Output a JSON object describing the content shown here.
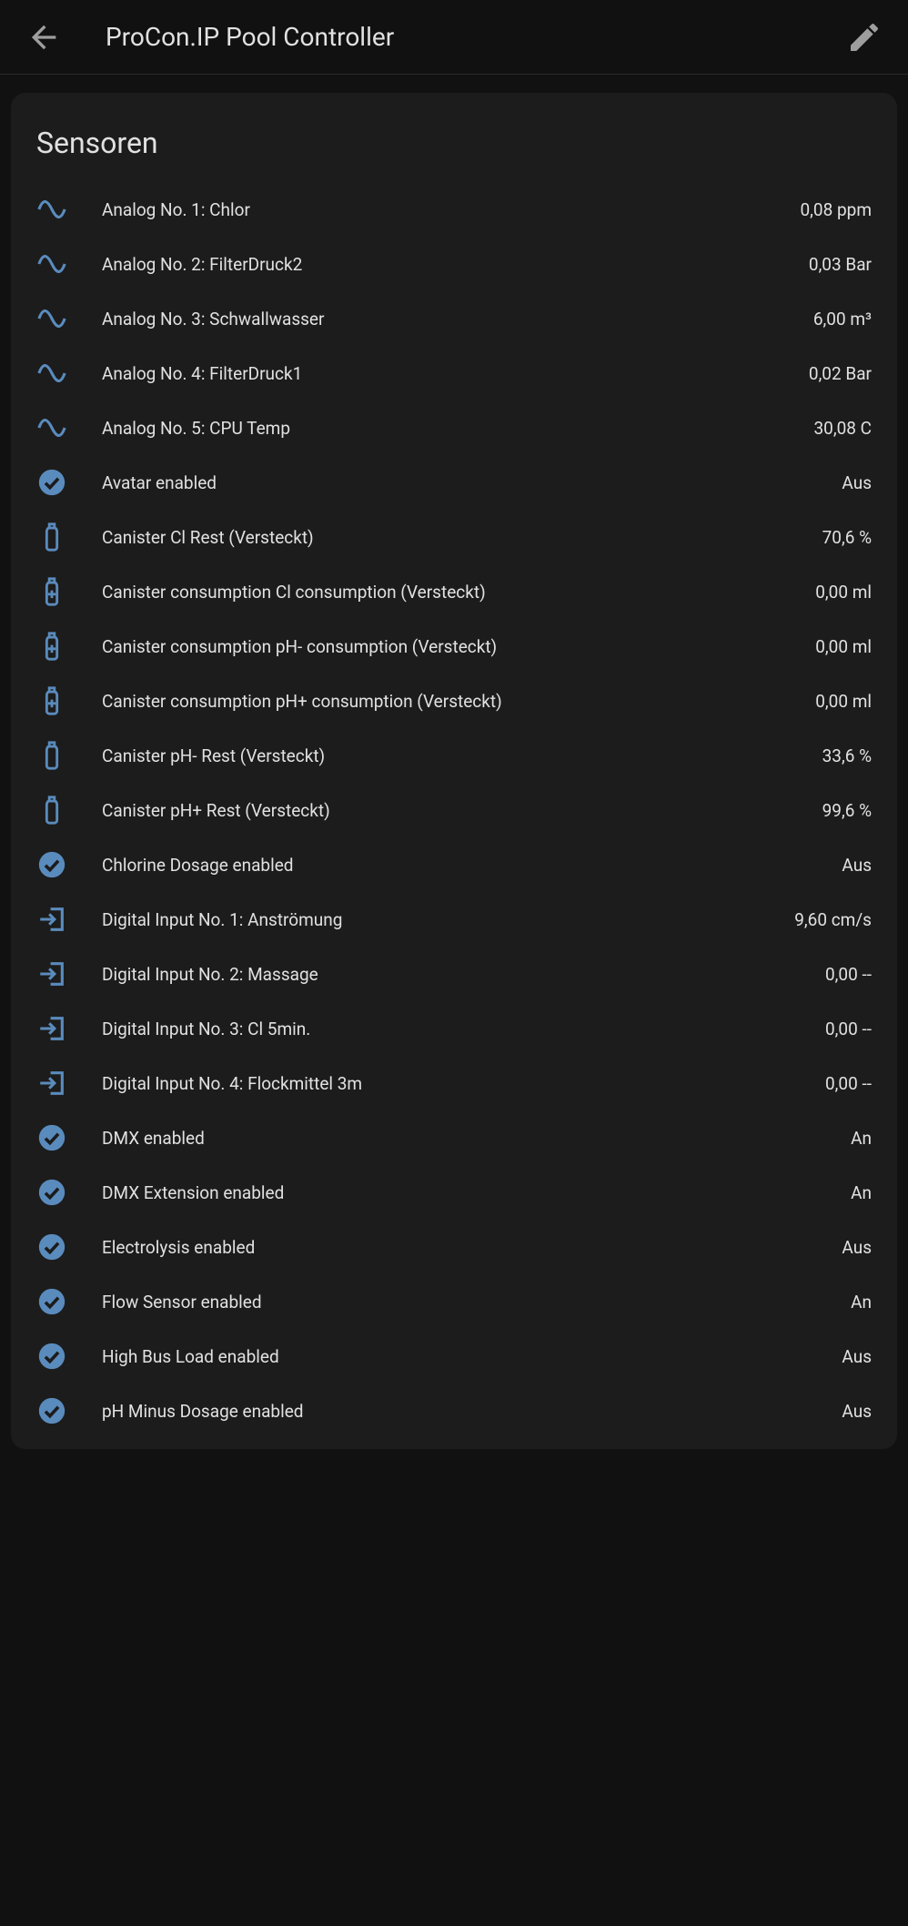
{
  "header": {
    "title": "ProCon.IP Pool Controller"
  },
  "card": {
    "title": "Sensoren",
    "items": [
      {
        "icon": "sine",
        "label": "Analog No. 1: Chlor",
        "value": "0,08 ppm"
      },
      {
        "icon": "sine",
        "label": "Analog No. 2: FilterDruck2",
        "value": "0,03 Bar"
      },
      {
        "icon": "sine",
        "label": "Analog No. 3: Schwallwasser",
        "value": "6,00 m³"
      },
      {
        "icon": "sine",
        "label": "Analog No. 4: FilterDruck1",
        "value": "0,02 Bar"
      },
      {
        "icon": "sine",
        "label": "Analog No. 5: CPU Temp",
        "value": "30,08 C"
      },
      {
        "icon": "check",
        "label": "Avatar enabled",
        "value": "Aus"
      },
      {
        "icon": "bottle",
        "label": "Canister Cl Rest (Versteckt)",
        "value": "70,6 %"
      },
      {
        "icon": "bottle-plus",
        "label": "Canister consumption Cl consumption (Versteckt)",
        "value": "0,00 ml"
      },
      {
        "icon": "bottle-plus",
        "label": "Canister consumption pH- consumption (Versteckt)",
        "value": "0,00 ml"
      },
      {
        "icon": "bottle-plus",
        "label": "Canister consumption pH+ consumption (Versteckt)",
        "value": "0,00 ml"
      },
      {
        "icon": "bottle",
        "label": "Canister pH- Rest (Versteckt)",
        "value": "33,6 %"
      },
      {
        "icon": "bottle",
        "label": "Canister pH+ Rest (Versteckt)",
        "value": "99,6 %"
      },
      {
        "icon": "check",
        "label": "Chlorine Dosage enabled",
        "value": "Aus"
      },
      {
        "icon": "input",
        "label": "Digital Input No. 1: Anströmung",
        "value": "9,60 cm/s"
      },
      {
        "icon": "input",
        "label": "Digital Input No. 2: Massage",
        "value": "0,00 --"
      },
      {
        "icon": "input",
        "label": "Digital Input No. 3: Cl 5min.",
        "value": "0,00 --"
      },
      {
        "icon": "input",
        "label": "Digital Input No. 4: Flockmittel 3m",
        "value": "0,00 --"
      },
      {
        "icon": "check",
        "label": "DMX enabled",
        "value": "An"
      },
      {
        "icon": "check",
        "label": "DMX Extension enabled",
        "value": "An"
      },
      {
        "icon": "check",
        "label": "Electrolysis enabled",
        "value": "Aus"
      },
      {
        "icon": "check",
        "label": "Flow Sensor enabled",
        "value": "An"
      },
      {
        "icon": "check",
        "label": "High Bus Load enabled",
        "value": "Aus"
      },
      {
        "icon": "check",
        "label": "pH Minus Dosage enabled",
        "value": "Aus"
      }
    ]
  }
}
